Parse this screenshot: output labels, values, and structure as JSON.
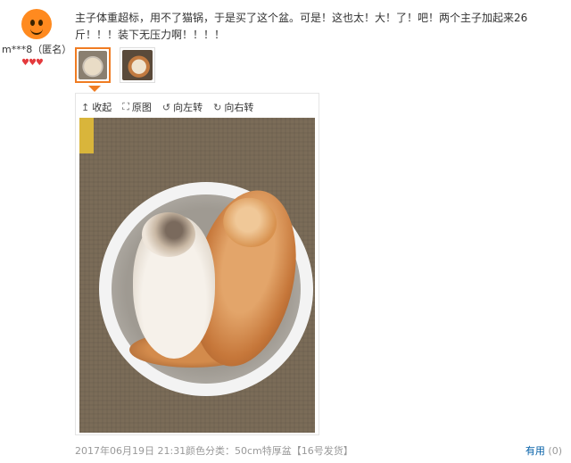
{
  "user": {
    "name": "m***8（匿名）",
    "hearts": "♥♥♥"
  },
  "review": {
    "text": "主子体重超标，用不了猫锅，于是买了这个盆。可是！这也太！大！了！吧！两个主子加起来26斤！！！装下无压力啊！！！！"
  },
  "viewer": {
    "collapse_label": "收起",
    "original_label": "原图",
    "rotate_left_label": "向左转",
    "rotate_right_label": "向右转"
  },
  "footer": {
    "date": "2017年06月19日 21:31",
    "spec": "颜色分类：50cm特厚盆【16号发货】",
    "useful_label": "有用",
    "useful_count": "(0)"
  },
  "icons": {
    "collapse": "arrow-up-icon",
    "original": "fullscreen-icon",
    "rotate_left": "rotate-left-icon",
    "rotate_right": "rotate-right-icon"
  },
  "colors": {
    "accent": "#f07c22",
    "link": "#005ea7",
    "heart": "#e4393c"
  }
}
